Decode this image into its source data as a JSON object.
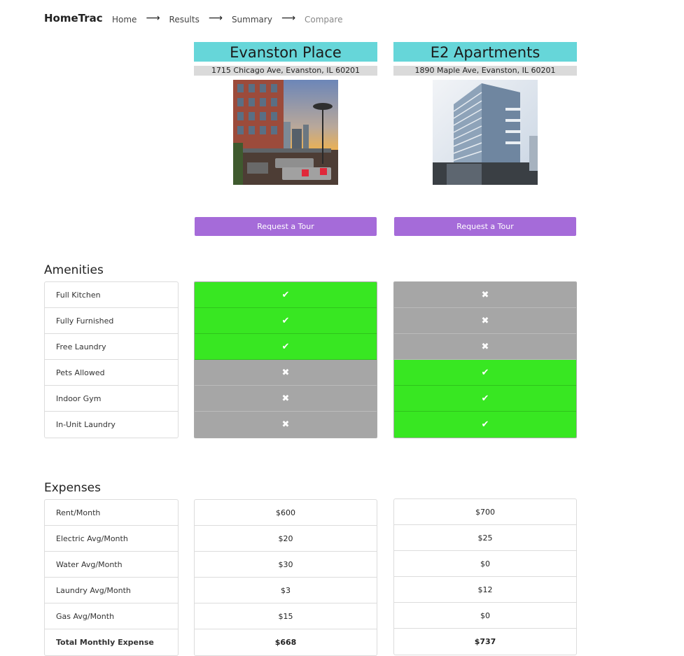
{
  "nav": {
    "brand": "HomeTrac",
    "breadcrumbs": [
      "Home",
      "Results",
      "Summary",
      "Compare"
    ]
  },
  "properties": [
    {
      "name": "Evanston Place",
      "address": "1715 Chicago Ave, Evanston, IL 60201",
      "tour_label": "Request a Tour"
    },
    {
      "name": "E2 Apartments",
      "address": "1890 Maple Ave, Evanston, IL 60201",
      "tour_label": "Request a Tour"
    }
  ],
  "amenities": {
    "title": "Amenities",
    "labels": [
      "Full Kitchen",
      "Fully Furnished",
      "Free Laundry",
      "Pets Allowed",
      "Indoor Gym",
      "In-Unit Laundry"
    ],
    "values": [
      [
        true,
        true,
        true,
        false,
        false,
        false
      ],
      [
        false,
        false,
        false,
        true,
        true,
        true
      ]
    ]
  },
  "expenses": {
    "title": "Expenses",
    "labels": [
      "Rent/Month",
      "Electric Avg/Month",
      "Water Avg/Month",
      "Laundry Avg/Month",
      "Gas Avg/Month",
      "Total Monthly Expense"
    ],
    "values": [
      [
        "$600",
        "$20",
        "$30",
        "$3",
        "$15",
        "$668"
      ],
      [
        "$700",
        "$25",
        "$0",
        "$12",
        "$0",
        "$737"
      ]
    ]
  },
  "colors": {
    "available": "#38e722",
    "unavailable": "#a6a6a6",
    "header": "#66d6d9",
    "button": "#a56bd9"
  }
}
